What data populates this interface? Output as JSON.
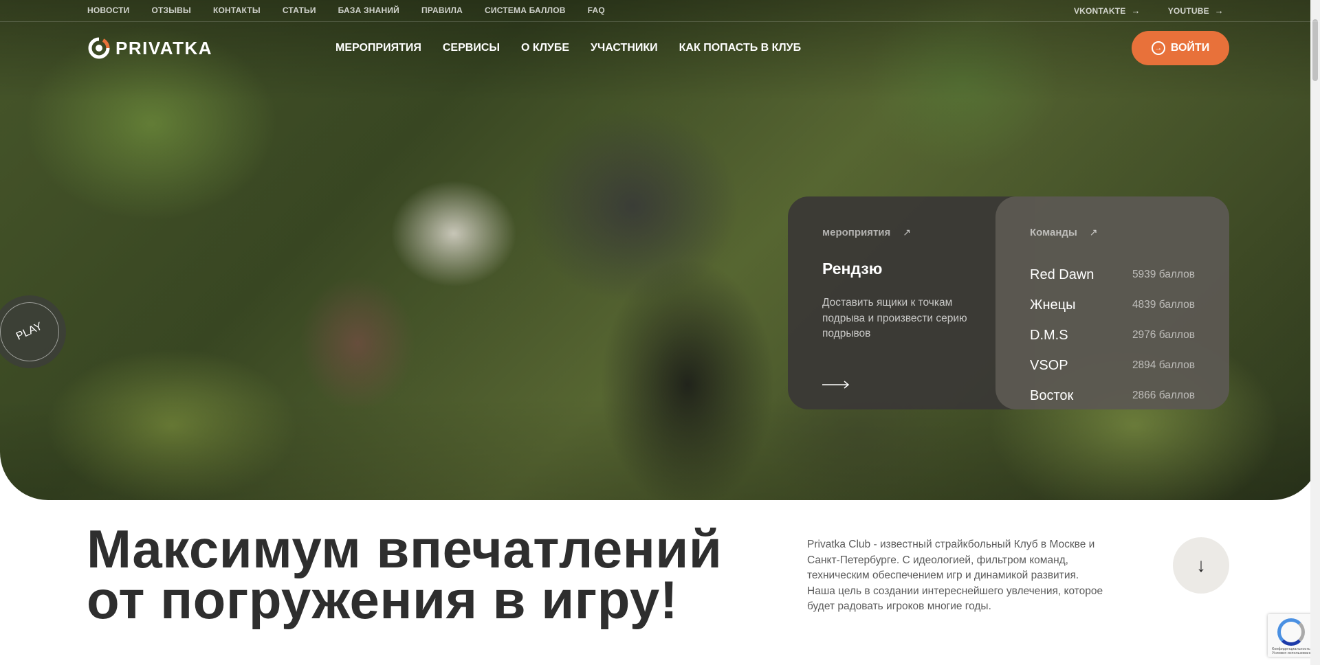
{
  "colors": {
    "accent": "#e8713a",
    "text_dark": "#2e2e2e",
    "card_dark": "#3a3836",
    "card_gray": "#5c5852"
  },
  "topbar": {
    "links": [
      "НОВОСТИ",
      "ОТЗЫВЫ",
      "КОНТАКТЫ",
      "СТАТЬИ",
      "БАЗА ЗНАНИЙ",
      "ПРАВИЛА",
      "СИСТЕМА БАЛЛОВ",
      "FAQ"
    ],
    "social": [
      {
        "label": "VKONTAKTE",
        "icon": "arrow-right-icon"
      },
      {
        "label": "YOUTUBE",
        "icon": "arrow-right-icon"
      }
    ]
  },
  "header": {
    "logo_text": "PRIVATKA",
    "nav": [
      "МЕРОПРИЯТИЯ",
      "СЕРВИСЫ",
      "О КЛУБЕ",
      "УЧАСТНИКИ",
      "КАК ПОПАСТЬ В КЛУБ"
    ],
    "login_label": "ВОЙТИ",
    "login_icon": "login-icon"
  },
  "hero": {
    "play_label": "PLAY",
    "events_card": {
      "heading": "мероприятия",
      "title": "Рендзю",
      "description": "Доставить ящики к точкам подрыва и произвести серию подрывов"
    },
    "teams_card": {
      "heading": "Команды",
      "teams": [
        {
          "name": "Red Dawn",
          "points": "5939 баллов"
        },
        {
          "name": "Жнецы",
          "points": "4839 баллов"
        },
        {
          "name": "D.M.S",
          "points": "2976 баллов"
        },
        {
          "name": "VSOP",
          "points": "2894 баллов"
        },
        {
          "name": "Восток",
          "points": "2866 баллов"
        }
      ]
    }
  },
  "intro": {
    "headline_line1": "Максимум впечатлений",
    "headline_line2": "от погружения в игру!",
    "about": "Privatka Club - известный страйкбольный Клуб в Москве и Санкт-Петербурге. С идеологией, фильтром команд, техническим обеспечением игр и динамикой развития. Наша цель в создании интереснейшего увлечения, которое будет радовать игроков многие годы."
  },
  "recaptcha": {
    "text": "Конфиденциальность - Условия использования"
  }
}
